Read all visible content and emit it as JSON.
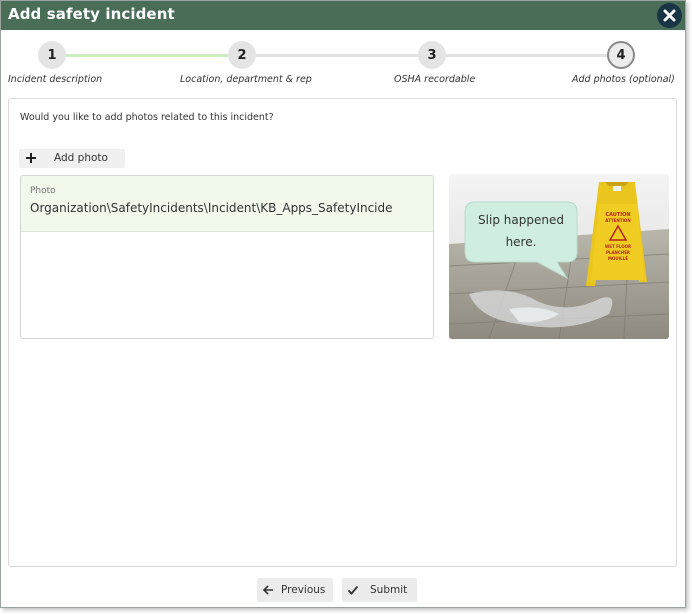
{
  "dialog": {
    "title": "Add safety incident",
    "close_icon": "close-icon"
  },
  "stepper": {
    "steps": [
      {
        "number": "1",
        "label": "Incident description"
      },
      {
        "number": "2",
        "label": "Location, department & rep"
      },
      {
        "number": "3",
        "label": "OSHA recordable"
      },
      {
        "number": "4",
        "label": "Add photos (optional)"
      }
    ],
    "current_step": 4,
    "completed_color": "#cdeec0",
    "pending_color": "#e2e2e2"
  },
  "content": {
    "prompt": "Would you like to add photos related to this incident?",
    "add_photo_label": "Add photo",
    "photo_field": {
      "label": "Photo",
      "value": "Organization\\SafetyIncidents\\Incident\\KB_Apps_SafetyIncide"
    },
    "photo": {
      "callout_line1": "Slip happened",
      "callout_line2": "here.",
      "sign_text1": "CAUTION",
      "sign_text2": "ATTENTION",
      "sign_text3": "WET FLOOR",
      "sign_text4": "PLANCHER",
      "sign_text5": "MOUILLÉ"
    }
  },
  "footer": {
    "previous_label": "Previous",
    "submit_label": "Submit"
  }
}
